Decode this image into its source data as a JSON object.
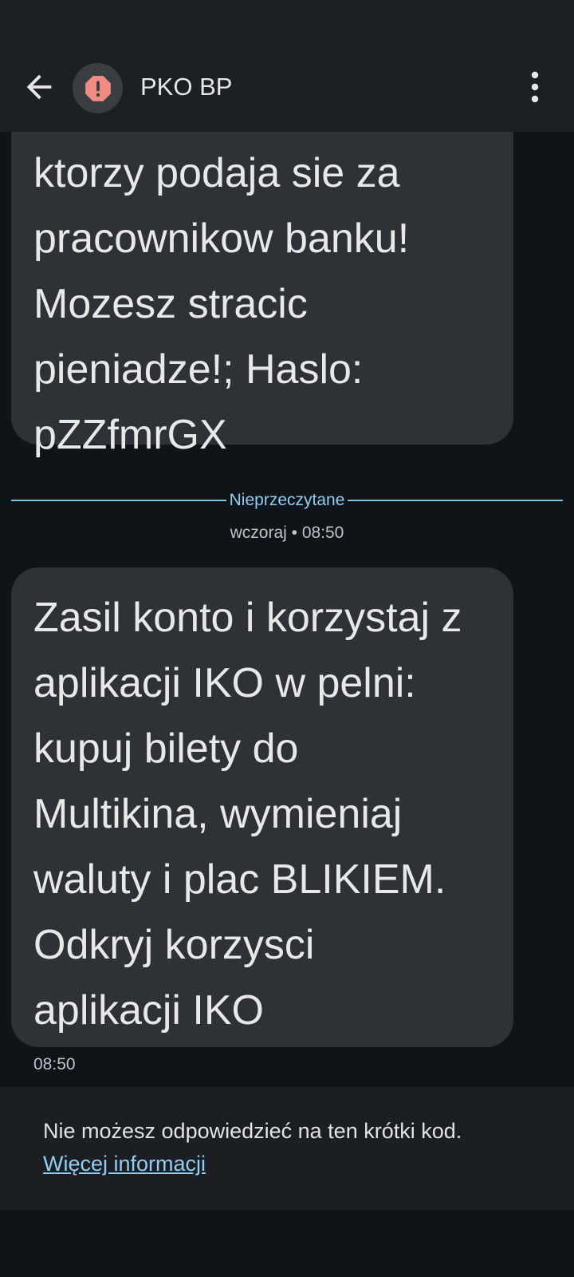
{
  "header": {
    "title": "PKO BP",
    "back_icon": "arrow-back-icon",
    "avatar_icon": "alert-octagon-icon",
    "more_icon": "more-vert-icon",
    "avatar_alert_color": "#f28b82"
  },
  "messages": [
    {
      "lines": [
        "ktorzy podaja sie za",
        "pracownikow banku!",
        "Mozesz stracic",
        "pieniadze!; Haslo:",
        "pZZfmrGX"
      ]
    },
    {
      "lines": [
        "Zasil konto i korzystaj z",
        "aplikacji IKO w pelni:",
        "kupuj bilety do",
        "Multikina, wymieniaj",
        "waluty i plac BLIKIEM.",
        "Odkryj korzysci",
        "aplikacji IKO"
      ],
      "time": "08:50"
    }
  ],
  "divider": {
    "label": "Nieprzeczytane"
  },
  "date_separator": "wczoraj • 08:50",
  "footer": {
    "notice": "Nie możesz odpowiedzieć na ten krótki kod.",
    "link": "Więcej informacji"
  },
  "colors": {
    "background": "#0f1419",
    "bubble": "#2e3135",
    "accent": "#8fcff3"
  }
}
